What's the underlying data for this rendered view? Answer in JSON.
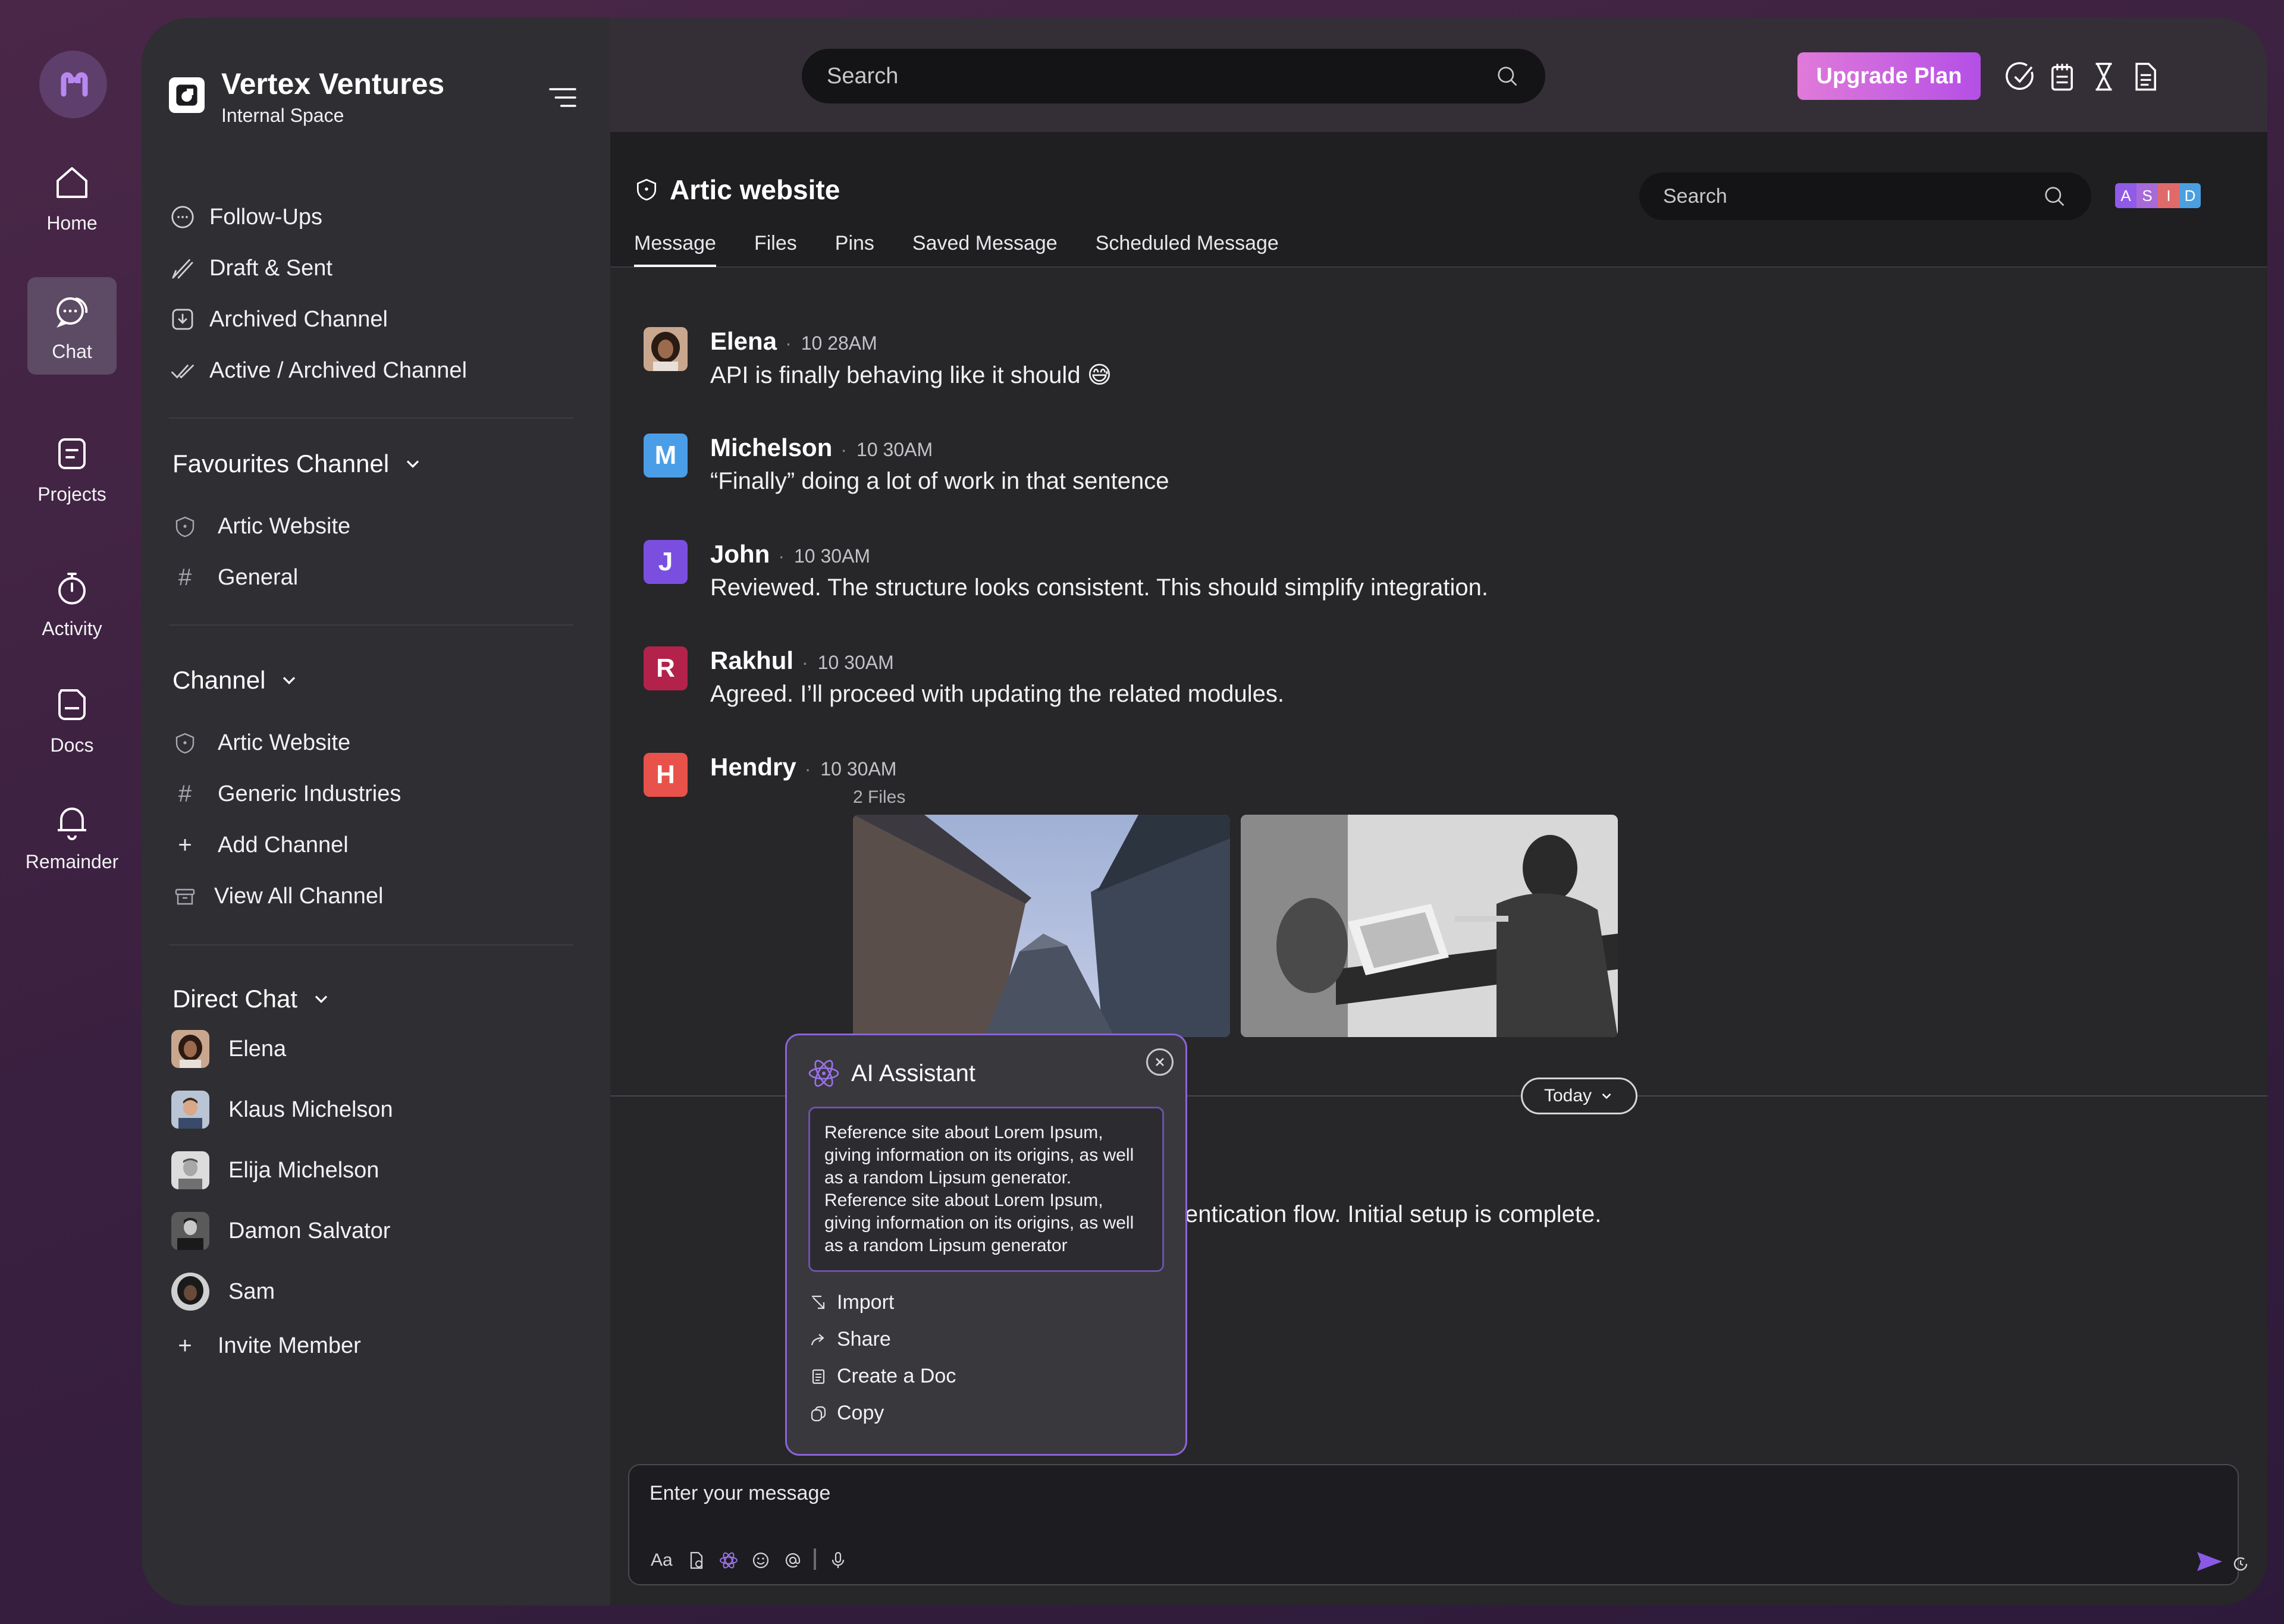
{
  "rail": {
    "items": [
      {
        "label": "Home",
        "icon": "home-icon"
      },
      {
        "label": "Chat",
        "icon": "chat-icon",
        "active": true
      },
      {
        "label": "Projects",
        "icon": "projects-icon"
      },
      {
        "label": "Activity",
        "icon": "stopwatch-icon"
      },
      {
        "label": "Docs",
        "icon": "docs-icon"
      },
      {
        "label": "Remainder",
        "icon": "bell-icon"
      }
    ]
  },
  "workspace": {
    "title": "Vertex Ventures",
    "subtitle": "Internal Space"
  },
  "sidebar": {
    "nav": [
      {
        "label": "Follow-Ups",
        "icon": "message-dots-icon"
      },
      {
        "label": "Draft & Sent",
        "icon": "pen-lines-icon"
      },
      {
        "label": "Archived Channel",
        "icon": "archive-download-icon"
      },
      {
        "label": "Active / Archived Channel",
        "icon": "double-check-icon"
      }
    ],
    "favourites": {
      "title": "Favourites Channel",
      "items": [
        {
          "label": "Artic Website",
          "icon": "shield-icon"
        },
        {
          "label": "General",
          "icon": "hash-icon"
        }
      ]
    },
    "channel": {
      "title": "Channel",
      "items": [
        {
          "label": "Artic Website",
          "icon": "shield-icon"
        },
        {
          "label": "Generic Industries",
          "icon": "hash-icon"
        },
        {
          "label": "Add Channel",
          "icon": "plus-icon"
        },
        {
          "label": "View All Channel",
          "icon": "box-icon"
        }
      ]
    },
    "direct": {
      "title": "Direct Chat",
      "items": [
        {
          "label": "Elena"
        },
        {
          "label": "Klaus Michelson"
        },
        {
          "label": "Elija Michelson"
        },
        {
          "label": "Damon Salvator"
        },
        {
          "label": "Sam"
        }
      ],
      "invite": "Invite Member"
    }
  },
  "topbar": {
    "search_placeholder": "Search",
    "upgrade_label": "Upgrade Plan"
  },
  "channel_view": {
    "title": "Artic website",
    "tabs": [
      "Message",
      "Files",
      "Pins",
      "Saved Message",
      "Scheduled Message"
    ],
    "search_placeholder": "Search",
    "badges": [
      "A",
      "S",
      "I",
      "D"
    ],
    "badge_colors": [
      "#8f5be8",
      "#a76ad8",
      "#e06a6a",
      "#4a9fe0"
    ]
  },
  "messages": [
    {
      "name": "Elena",
      "time": "10 28AM",
      "text": "API is finally behaving like it should 😅"
    },
    {
      "name": "Michelson",
      "initial": "M",
      "color": "#4a9ee8",
      "time": "10 30AM",
      "text": "“Finally” doing a lot of work in that sentence"
    },
    {
      "name": "John",
      "initial": "J",
      "color": "#7a4fe0",
      "time": "10 30AM",
      "text": "Reviewed. The structure looks consistent. This should simplify integration."
    },
    {
      "name": "Rakhul",
      "initial": "R",
      "color": "#b3224a",
      "time": "10 30AM",
      "text": "Agreed. I’ll proceed with updating the related modules."
    },
    {
      "name": "Hendry",
      "initial": "H",
      "color": "#e8524a",
      "time": "10 30AM",
      "files_label": "2 Files"
    }
  ],
  "divider_label": "Today",
  "partial_message": "entication flow. Initial setup is complete.",
  "ai_assistant": {
    "title": "AI Assistant",
    "body": "Reference site about Lorem Ipsum, giving information on its origins, as well as a random Lipsum generator. Reference site about Lorem Ipsum, giving information on its origins, as well as a random Lipsum generator",
    "actions": [
      "Import",
      "Share",
      "Create a Doc",
      "Copy"
    ]
  },
  "composer": {
    "placeholder": "Enter your message",
    "format_label": "Aa"
  },
  "colors": {
    "accent": "#8c63d8",
    "upgrade_start": "#e07ad9",
    "upgrade_end": "#b44fe6"
  }
}
